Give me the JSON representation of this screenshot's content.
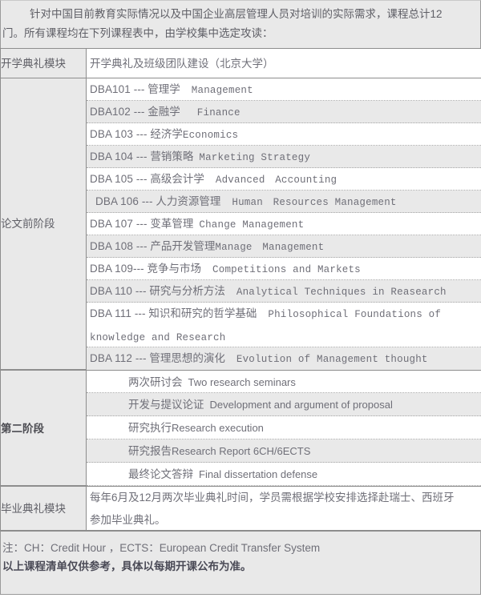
{
  "intro": {
    "line1": "针对中国目前教育实际情况以及中国企业高层管理人员对培训的实际需求，课程总计12",
    "line2": "门。所有课程均在下列课程表中，由学校集中选定攻读："
  },
  "table": {
    "modules": {
      "opening": "开学典礼模块",
      "pre_thesis": "论文前阶段",
      "stage_two": "第二阶段",
      "graduation": "毕业典礼模块"
    },
    "opening_content": "开学典礼及班级团队建设（北京大学）",
    "courses": [
      {
        "code": "DBA101 ---",
        "cn": "管理学",
        "en": "Management"
      },
      {
        "code": "DBA102 ---",
        "cn": "金融学",
        "en": "Finance"
      },
      {
        "code": "DBA 103 ---",
        "cn": "经济学",
        "en": "Economics"
      },
      {
        "code": "DBA 104 ---",
        "cn": "营销策略",
        "en": "Marketing Strategy"
      },
      {
        "code": "DBA 105 ---",
        "cn": "高级会计学",
        "en": "Advanced　Accounting"
      },
      {
        "code": "DBA 106 ---",
        "cn": "人力资源管理",
        "en": "Human　Resources Management"
      },
      {
        "code": "DBA 107 ---",
        "cn": "变革管理",
        "en": "Change Management"
      },
      {
        "code": "DBA 108 ---",
        "cn": "产品开发管理",
        "en": "Manage　Management"
      },
      {
        "code": "DBA 109---",
        "cn": "竞争与市场",
        "en": "Competitions and Markets"
      },
      {
        "code": "DBA 110 ---",
        "cn": "研究与分析方法",
        "en": "Analytical Techniques in Reasearch"
      },
      {
        "code": "DBA 111 ---",
        "cn": "知识和研究的哲学基础",
        "en": "Philosophical Foundations of knowledge and Research"
      },
      {
        "code": "DBA 112 ---",
        "cn": "管理思想的演化",
        "en": "Evolution of Management thought"
      }
    ],
    "stage_two_items": [
      {
        "cn": "两次研讨会",
        "en": "Two research seminars"
      },
      {
        "cn": "开发与提议论证",
        "en": "Development  and argument of proposal"
      },
      {
        "cn": "研究执行",
        "en": "Research execution"
      },
      {
        "cn": "研究报告",
        "en": "Research Report 6CH/6ECTS"
      },
      {
        "cn": "最终论文答辩",
        "en": "Final dissertation defense"
      }
    ],
    "graduation_content_line1": "每年6月及12月两次毕业典礼时间，学员需根据学校安排选择赴瑞士、西班牙",
    "graduation_content_line2": "参加毕业典礼。"
  },
  "footer": {
    "note": "注：CH：Credit Hour ，ECTS：European Credit  Transfer System",
    "disclaimer": "以上课程清单仅供参考，具体以每期开课公布为准。"
  },
  "colors": {
    "row_alt": "#e9e9e9",
    "row_plain": "#ffffff",
    "border": "#8d8d8d",
    "text": "#6f6f78"
  }
}
